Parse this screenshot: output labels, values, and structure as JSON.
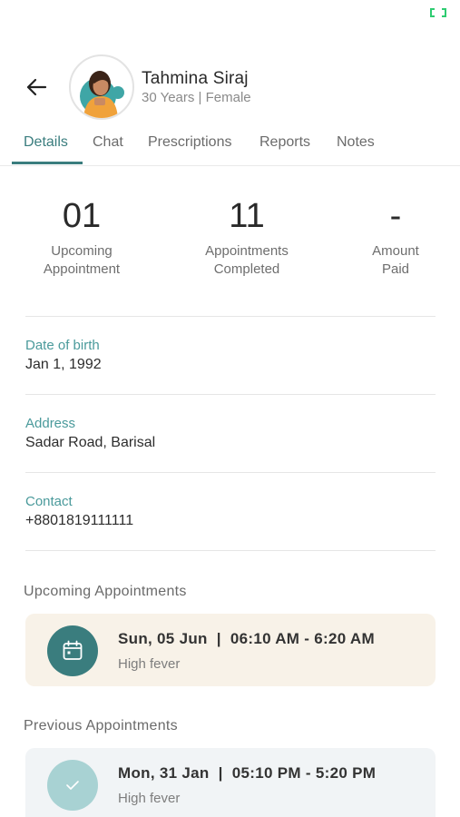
{
  "colors": {
    "accent": "#3a7d7e",
    "label_teal": "#4a9a9b",
    "upcoming_card_bg": "#f8f2e8",
    "previous_card_bg": "#f1f4f6",
    "previous_circle": "#a8d2d3",
    "status_icon": "#2ecc71"
  },
  "patient": {
    "name": "Tahmina Siraj",
    "age_gender": "30 Years | Female"
  },
  "tabs": [
    {
      "label": "Details",
      "active": true
    },
    {
      "label": "Chat",
      "active": false
    },
    {
      "label": "Prescriptions",
      "active": false
    },
    {
      "label": "Reports",
      "active": false
    },
    {
      "label": "Notes",
      "active": false
    }
  ],
  "stats": [
    {
      "value": "01",
      "label": "Upcoming\nAppointment"
    },
    {
      "value": "11",
      "label": "Appointments\nCompleted"
    },
    {
      "value": "-",
      "label": "Amount\nPaid"
    }
  ],
  "details": {
    "dob_label": "Date of birth",
    "dob_value": "Jan 1, 1992",
    "address_label": "Address",
    "address_value": "Sadar Road, Barisal",
    "contact_label": "Contact",
    "contact_value": "+8801819111111"
  },
  "upcoming": {
    "title": "Upcoming Appointments",
    "items": [
      {
        "datetime": "Sun, 05 Jun  |  06:10 AM - 6:20 AM",
        "note": "High fever",
        "icon": "calendar-icon"
      }
    ]
  },
  "previous": {
    "title": "Previous Appointments",
    "items": [
      {
        "datetime": "Mon, 31 Jan  |  05:10 PM - 5:20 PM",
        "note": "High fever",
        "icon": "check-icon"
      }
    ]
  }
}
